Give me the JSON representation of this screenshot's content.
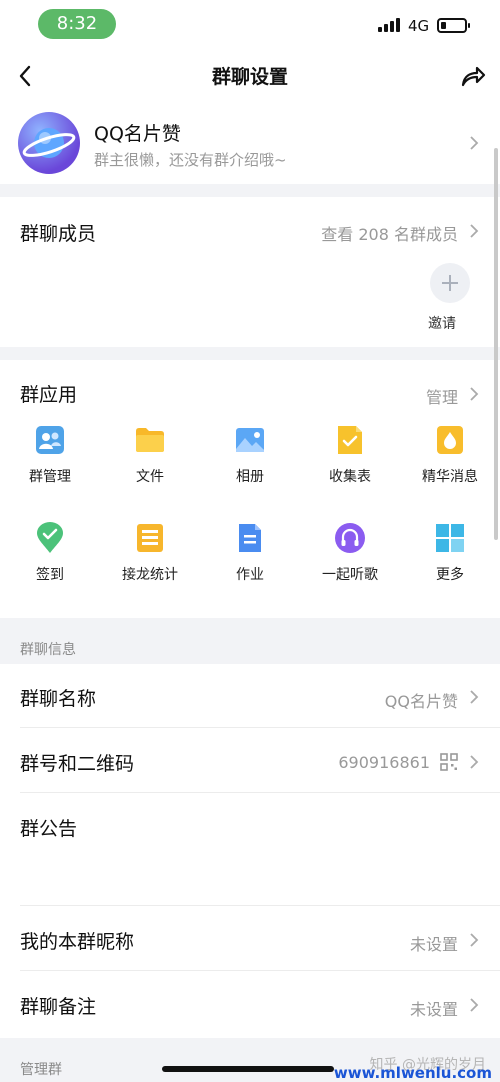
{
  "status_bar": {
    "time": "8:32",
    "network": "4G"
  },
  "nav": {
    "title": "群聊设置"
  },
  "group": {
    "name": "QQ名片赞",
    "intro": "群主很懒，还没有群介绍哦~"
  },
  "members": {
    "title": "群聊成员",
    "view_all": "查看 208 名群成员",
    "invite_label": "邀请"
  },
  "apps": {
    "title": "群应用",
    "manage": "管理",
    "items": [
      {
        "label": "群管理",
        "icon": "group-manage-icon"
      },
      {
        "label": "文件",
        "icon": "folder-icon"
      },
      {
        "label": "相册",
        "icon": "photo-album-icon"
      },
      {
        "label": "收集表",
        "icon": "collection-form-icon"
      },
      {
        "label": "精华消息",
        "icon": "essence-message-icon"
      },
      {
        "label": "签到",
        "icon": "check-in-icon"
      },
      {
        "label": "接龙统计",
        "icon": "relay-stats-icon"
      },
      {
        "label": "作业",
        "icon": "homework-icon"
      },
      {
        "label": "一起听歌",
        "icon": "listen-together-icon"
      },
      {
        "label": "更多",
        "icon": "more-apps-icon"
      }
    ]
  },
  "info": {
    "section_label": "群聊信息",
    "name_label": "群聊名称",
    "name_value": "QQ名片赞",
    "number_label": "群号和二维码",
    "number_value": "690916861",
    "notice_label": "群公告",
    "nickname_label": "我的本群昵称",
    "nickname_value": "未设置",
    "remark_label": "群聊备注",
    "remark_value": "未设置"
  },
  "manage_group": {
    "section_label": "管理群"
  },
  "watermark": {
    "text": "知乎 @光辉的岁月",
    "site": "www.mlwenlu.com"
  },
  "colors": {
    "status_time_bg": "#5cb968",
    "secondary_text": "#999999",
    "accent_blue": "#4a8cf0"
  }
}
